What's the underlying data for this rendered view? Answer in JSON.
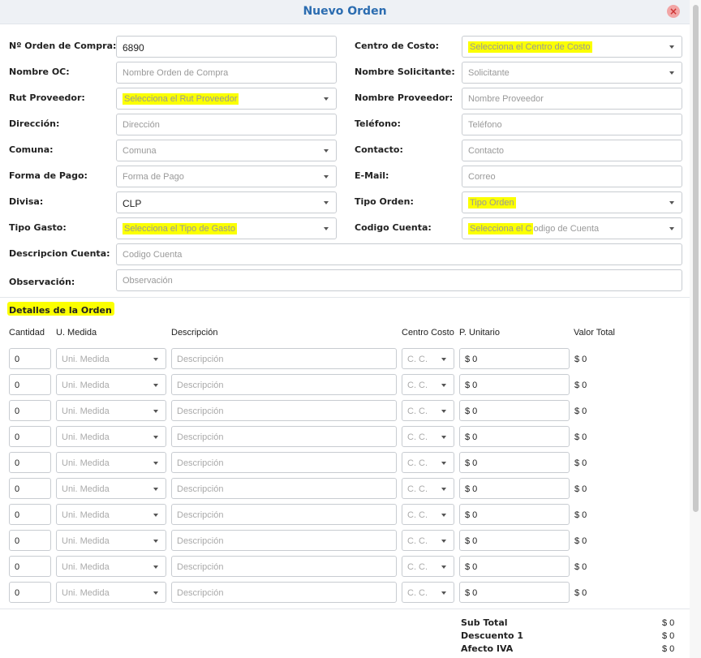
{
  "modal": {
    "title": "Nuevo Orden",
    "close_glyph": "×"
  },
  "form": {
    "orden_compra": {
      "label": "Nº Orden de Compra:",
      "value": "6890"
    },
    "nombre_oc": {
      "label": "Nombre OC:",
      "placeholder": "Nombre Orden de Compra"
    },
    "rut_proveedor": {
      "label": "Rut Proveedor:",
      "placeholder": "Selecciona el Rut Proveedor"
    },
    "direccion": {
      "label": "Dirección:",
      "placeholder": "Dirección"
    },
    "comuna": {
      "label": "Comuna:",
      "placeholder": "Comuna"
    },
    "forma_pago": {
      "label": "Forma de Pago:",
      "placeholder": "Forma de Pago"
    },
    "divisa": {
      "label": "Divisa:",
      "value": "CLP"
    },
    "tipo_gasto": {
      "label": "Tipo Gasto:",
      "placeholder": "Selecciona el Tipo de Gasto"
    },
    "descripcion_cuenta": {
      "label": "Descripcion Cuenta:",
      "placeholder": "Codigo Cuenta"
    },
    "observacion": {
      "label": "Observación:",
      "placeholder": "Observación"
    },
    "centro_costo": {
      "label": "Centro de Costo:",
      "placeholder": "Selecciona el Centro de Costo"
    },
    "nombre_solicitante": {
      "label": "Nombre Solicitante:",
      "placeholder": "Solicitante"
    },
    "nombre_proveedor": {
      "label": "Nombre Proveedor:",
      "placeholder": "Nombre Proveedor"
    },
    "telefono": {
      "label": "Teléfono:",
      "placeholder": "Teléfono"
    },
    "contacto": {
      "label": "Contacto:",
      "placeholder": "Contacto"
    },
    "email": {
      "label": "E-Mail:",
      "placeholder": "Correo"
    },
    "tipo_orden": {
      "label": "Tipo Orden:",
      "placeholder": "Tipo Orden"
    },
    "codigo_cuenta": {
      "label": "Codigo Cuenta:",
      "placeholder_part1": "Selecciona el C",
      "placeholder_part2": "odigo de Cuenta"
    }
  },
  "details": {
    "title": "Detalles de la Orden",
    "columns": [
      "Cantidad",
      "U. Medida",
      "Descripción",
      "Centro Costo",
      "P. Unitario",
      "Valor Total"
    ],
    "rows": [
      {
        "cantidad": "0",
        "unidad": "Uni. Medida",
        "descripcion": "Descripción",
        "centro": "C. C.",
        "precio": "$ 0",
        "total": "$ 0"
      },
      {
        "cantidad": "0",
        "unidad": "Uni. Medida",
        "descripcion": "Descripción",
        "centro": "C. C.",
        "precio": "$ 0",
        "total": "$ 0"
      },
      {
        "cantidad": "0",
        "unidad": "Uni. Medida",
        "descripcion": "Descripción",
        "centro": "C. C.",
        "precio": "$ 0",
        "total": "$ 0"
      },
      {
        "cantidad": "0",
        "unidad": "Uni. Medida",
        "descripcion": "Descripción",
        "centro": "C. C.",
        "precio": "$ 0",
        "total": "$ 0"
      },
      {
        "cantidad": "0",
        "unidad": "Uni. Medida",
        "descripcion": "Descripción",
        "centro": "C. C.",
        "precio": "$ 0",
        "total": "$ 0"
      },
      {
        "cantidad": "0",
        "unidad": "Uni. Medida",
        "descripcion": "Descripción",
        "centro": "C. C.",
        "precio": "$ 0",
        "total": "$ 0"
      },
      {
        "cantidad": "0",
        "unidad": "Uni. Medida",
        "descripcion": "Descripción",
        "centro": "C. C.",
        "precio": "$ 0",
        "total": "$ 0"
      },
      {
        "cantidad": "0",
        "unidad": "Uni. Medida",
        "descripcion": "Descripción",
        "centro": "C. C.",
        "precio": "$ 0",
        "total": "$ 0"
      },
      {
        "cantidad": "0",
        "unidad": "Uni. Medida",
        "descripcion": "Descripción",
        "centro": "C. C.",
        "precio": "$ 0",
        "total": "$ 0"
      },
      {
        "cantidad": "0",
        "unidad": "Uni. Medida",
        "descripcion": "Descripción",
        "centro": "C. C.",
        "precio": "$ 0",
        "total": "$ 0"
      }
    ]
  },
  "summary": {
    "items": [
      {
        "label": "Sub Total",
        "value": "$ 0"
      },
      {
        "label": "Descuento 1",
        "value": "$ 0"
      },
      {
        "label": "Afecto IVA",
        "value": "$ 0"
      }
    ]
  },
  "colors": {
    "accent": "#2b6cb0",
    "highlight": "#fbff00",
    "close": "#f2a5a5"
  }
}
